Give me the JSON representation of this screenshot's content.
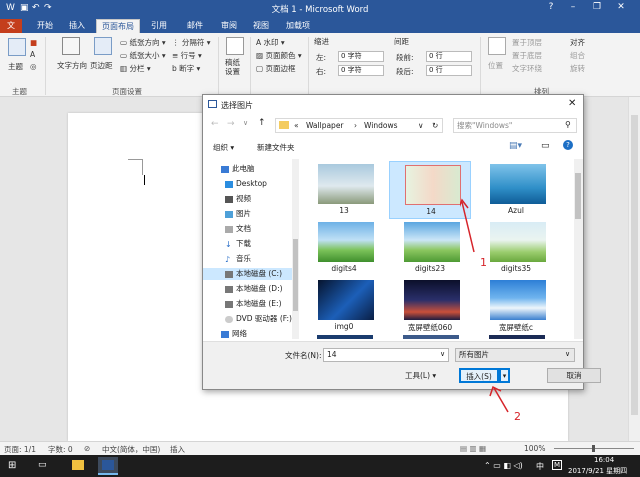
{
  "window": {
    "title": "文档 1 - Microsoft Word"
  },
  "tabs": [
    "开始",
    "插入",
    "页面布局",
    "引用",
    "邮件",
    "审阅",
    "视图",
    "加载项"
  ],
  "active_tab": "页面布局",
  "ribbon": {
    "theme_label": "主题",
    "text_direction": "文字方向",
    "margins": "页边距",
    "orientation": "纸张方向",
    "size": "纸张大小",
    "columns": "分栏",
    "breaks": "分隔符",
    "line_numbers": "行号",
    "hyphenation": "断字",
    "draft": "稿纸\n设置",
    "watermark": "水印",
    "page_color": "页面颜色",
    "page_borders": "页面边框",
    "indent_label": "缩进",
    "spacing_label": "间距",
    "indent_left": "0 字符",
    "indent_right": "0 字符",
    "space_before": "0 行",
    "space_after": "0 行",
    "left_label": "左:",
    "right_label": "右:",
    "before_label": "段前:",
    "after_label": "段后:",
    "position": "位置",
    "bring_forward": "置于顶层",
    "send_backward": "置于底层",
    "wrap_text": "文字环绕",
    "align": "对齐",
    "group": "组合",
    "rotate": "旋转",
    "group_theme": "主题",
    "group_page_setup": "页面设置",
    "group_arrange": "排列"
  },
  "dialog": {
    "title": "选择图片",
    "address_parts": [
      "«",
      "Wallpaper",
      "›",
      "Windows"
    ],
    "search_placeholder": "搜索\"Windows\"",
    "organize": "组织 ▾",
    "new_folder": "新建文件夹",
    "nav_items": [
      "此电脑",
      "Desktop",
      "视频",
      "图片",
      "文档",
      "下载",
      "音乐",
      "本地磁盘 (C:)",
      "本地磁盘 (D:)",
      "本地磁盘 (E:)",
      "DVD 驱动器 (F:)",
      "网络"
    ],
    "selected_nav": "本地磁盘 (C:)",
    "files": [
      "13",
      "14",
      "Azul",
      "digits4",
      "digits23",
      "digits35",
      "img0",
      "宽屏壁纸060",
      "宽屏壁纸c"
    ],
    "selected_file": "14",
    "filename_label": "文件名(N):",
    "filename_value": "14",
    "filetype_value": "所有图片",
    "tools": "工具(L)",
    "insert": "插入(S)",
    "cancel": "取消"
  },
  "annotations": [
    "1",
    "2"
  ],
  "status": {
    "page": "页面: 1/1",
    "words": "字数: 0",
    "lang": "中文(简体，中国)",
    "mode": "插入",
    "zoom": "100%"
  },
  "taskbar": {
    "time": "16:04",
    "date": "2017/9/21 星期四",
    "ime": "中"
  },
  "colors": {
    "word_blue": "#2b579a",
    "selection": "#cce8ff",
    "annotation_red": "#d6242a"
  }
}
